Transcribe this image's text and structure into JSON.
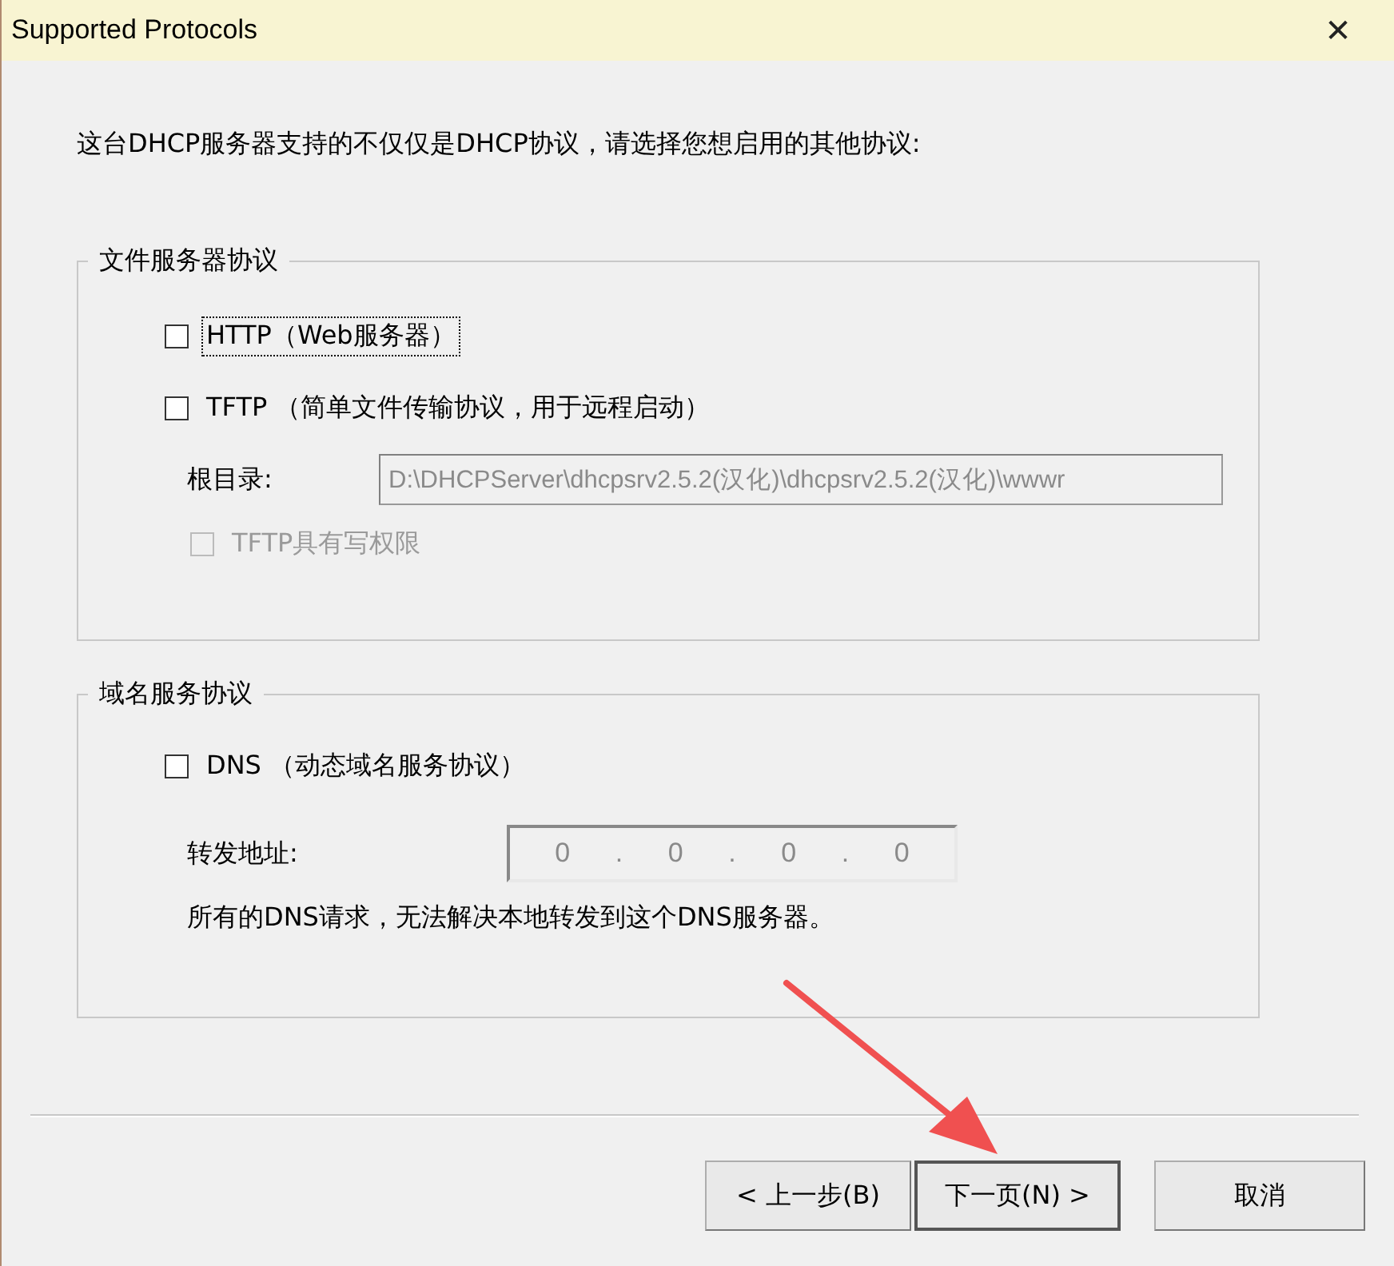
{
  "window": {
    "title": "Supported Protocols",
    "close": "✕"
  },
  "intro": "这台DHCP服务器支持的不仅仅是DHCP协议，请选择您想启用的其他协议:",
  "file_group": {
    "title": "文件服务器协议",
    "options": [
      {
        "label": "HTTP（Web服务器）",
        "checked": false,
        "disabled": false,
        "focused": true
      },
      {
        "label": "TFTP （简单文件传输协议，用于远程启动）",
        "checked": false,
        "disabled": false,
        "focused": false
      }
    ],
    "root_label": "根目录:",
    "root_value": "D:\\DHCPServer\\dhcpsrv2.5.2(汉化)\\dhcpsrv2.5.2(汉化)\\wwwr",
    "root_disabled": true,
    "write_option": {
      "label": "TFTP具有写权限",
      "checked": false,
      "disabled": true,
      "focused": false
    }
  },
  "dns_group": {
    "title": "域名服务协议",
    "option": {
      "label": "DNS （动态域名服务协议）",
      "checked": false,
      "disabled": false,
      "focused": false
    },
    "forward_label": "转发地址:",
    "ip_parts": [
      "0",
      ".",
      "0",
      ".",
      "0",
      ".",
      "0"
    ],
    "note": "所有的DNS请求，无法解决本地转发到这个DNS服务器。"
  },
  "buttons": [
    {
      "label": "< 上一步(B)",
      "default": false
    },
    {
      "label": "下一页(N) >",
      "default": true
    },
    {
      "label": "取消",
      "default": false
    }
  ]
}
